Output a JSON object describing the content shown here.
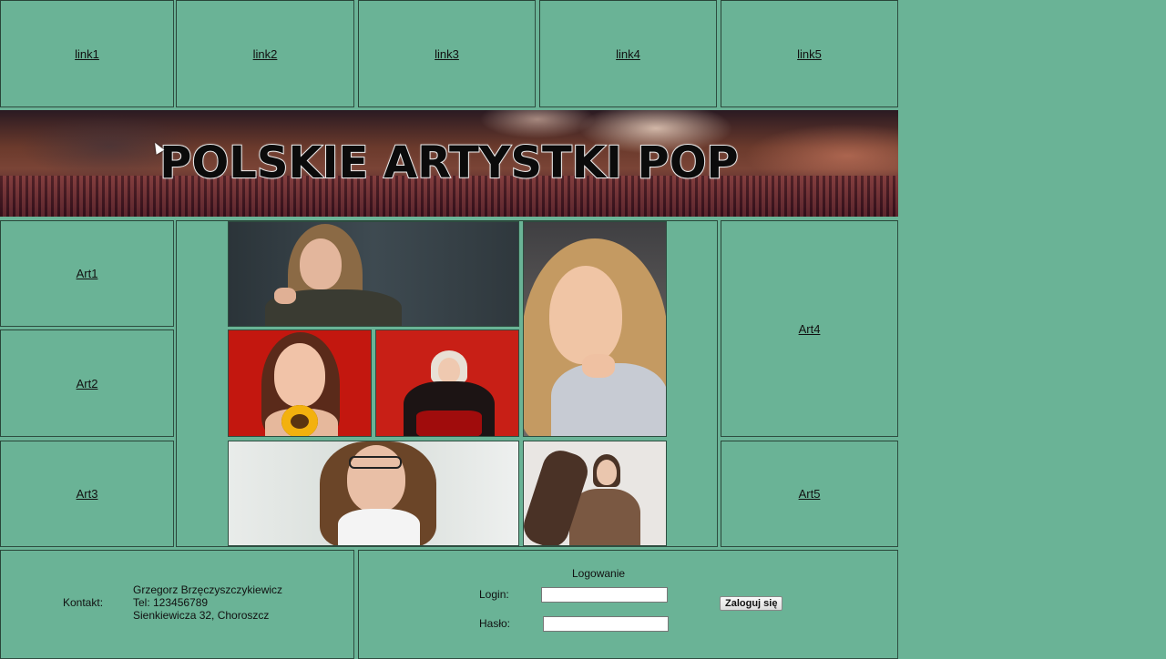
{
  "nav": {
    "links": [
      "link1",
      "link2",
      "link3",
      "link4",
      "link5"
    ]
  },
  "banner": {
    "title": "POLSKIE ARTYSTKI POP"
  },
  "artists": {
    "left": [
      "Art1",
      "Art2",
      "Art3"
    ],
    "right": [
      "Art4",
      "Art5"
    ]
  },
  "contact": {
    "label": "Kontakt:",
    "name": "Grzegorz Brzęczyszczykiewicz",
    "phone": "Tel: 123456789",
    "address": "Sienkiewicza 32, Choroszcz"
  },
  "login": {
    "heading": "Logowanie",
    "login_label": "Login:",
    "password_label": "Hasło:",
    "login_value": "",
    "password_value": "",
    "submit_label": "Zaloguj się"
  },
  "colors": {
    "background": "#6ab396",
    "border": "#2e4d40"
  }
}
